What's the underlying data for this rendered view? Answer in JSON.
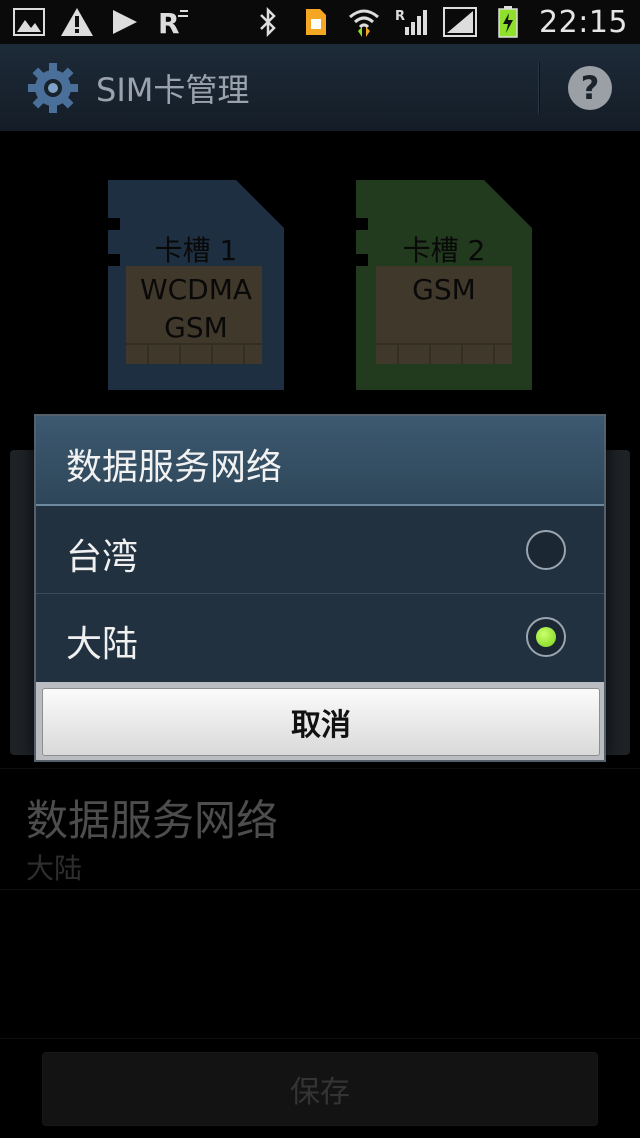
{
  "status_bar": {
    "time": "22:15",
    "left_icons": [
      "gallery-icon",
      "warning-icon",
      "play-icon",
      "roaming-icon"
    ],
    "right_icons": [
      "bluetooth-icon",
      "sim-icon",
      "wifi-icon",
      "signal-r-icon",
      "signal-icon",
      "battery-charging-icon"
    ],
    "signal_roaming_letter": "R"
  },
  "action_bar": {
    "title": "SIM卡管理",
    "help_symbol": "?"
  },
  "sim_cards": [
    {
      "label": "卡槽 1",
      "lines": [
        "WCDMA",
        "GSM"
      ],
      "color": "#3a5778"
    },
    {
      "label": "卡槽 2",
      "lines": [
        "GSM"
      ],
      "color": "#3e6a35"
    }
  ],
  "dialog": {
    "title": "数据服务网络",
    "options": [
      {
        "label": "台湾",
        "selected": false
      },
      {
        "label": "大陆",
        "selected": true
      }
    ],
    "cancel_label": "取消"
  },
  "preference": {
    "title": "数据服务网络",
    "value": "大陆"
  },
  "save_label": "保存",
  "colors": {
    "accent_selected": "#8fe02a",
    "dialog_header": "#3c5970"
  }
}
